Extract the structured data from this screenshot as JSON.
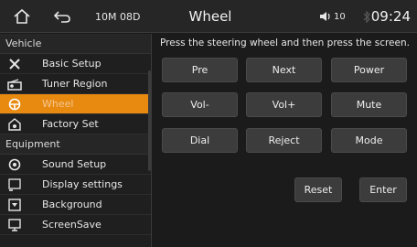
{
  "status_bar": {
    "memory": "10M 08D",
    "title": "Wheel",
    "volume": "10",
    "time": "09:24"
  },
  "sidebar": {
    "sections": [
      {
        "label": "Vehicle",
        "items": [
          {
            "label": "Basic Setup",
            "icon": "tools-icon"
          },
          {
            "label": "Tuner Region",
            "icon": "radio-icon"
          },
          {
            "label": "Wheel",
            "icon": "steering-wheel-icon",
            "active": true
          },
          {
            "label": "Factory Set",
            "icon": "factory-icon"
          }
        ]
      },
      {
        "label": "Equipment",
        "items": [
          {
            "label": "Sound Setup",
            "icon": "sound-icon"
          },
          {
            "label": "Display settings",
            "icon": "display-icon"
          },
          {
            "label": "Background",
            "icon": "background-icon"
          },
          {
            "label": "ScreenSave",
            "icon": "monitor-icon"
          }
        ]
      }
    ]
  },
  "main": {
    "instruction": "Press the steering wheel and then press the screen.",
    "buttons": [
      "Pre",
      "Next",
      "Power",
      "Vol-",
      "Vol+",
      "Mute",
      "Dial",
      "Reject",
      "Mode"
    ],
    "reset_label": "Reset",
    "enter_label": "Enter"
  },
  "colors": {
    "accent": "#e88a10",
    "background": "#1b1b1b",
    "button": "#3c3c3c"
  }
}
